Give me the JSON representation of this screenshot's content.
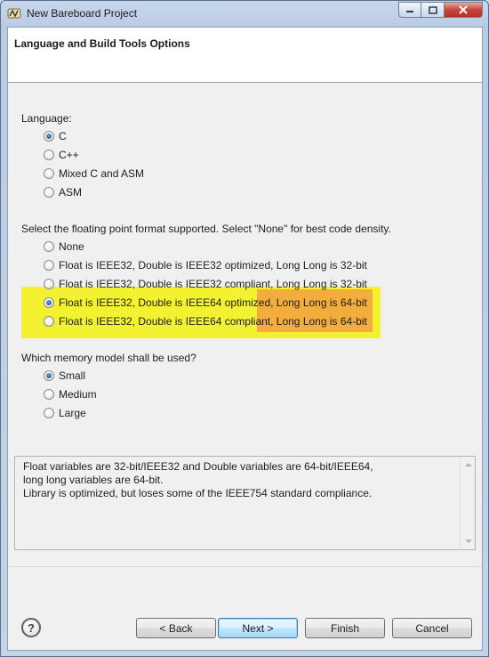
{
  "window": {
    "title": "New Bareboard Project",
    "controls": {
      "minimize": "minimize",
      "maximize": "maximize",
      "close": "close"
    }
  },
  "header": {
    "title": "Language and Build Tools Options"
  },
  "language": {
    "label": "Language:",
    "options": [
      "C",
      "C++",
      "Mixed C and ASM",
      "ASM"
    ],
    "selected": "C"
  },
  "float_format": {
    "label": "Select the floating point format supported. Select \"None\" for best code density.",
    "options": [
      "None",
      "Float is IEEE32, Double is IEEE32 optimized, Long Long is 32-bit",
      "Float is IEEE32, Double is IEEE32 compliant, Long Long is 32-bit",
      "Float is IEEE32, Double is IEEE64 optimized, Long Long is 64-bit",
      "Float is IEEE32, Double is IEEE64 compliant, Long Long is 64-bit"
    ],
    "selected": "Float is IEEE32, Double is IEEE64 optimized, Long Long is 64-bit",
    "highlight_colors": {
      "yellow": "#f2f230",
      "orange": "#f2ad3c"
    }
  },
  "memory_model": {
    "label": "Which memory model shall be used?",
    "options": [
      "Small",
      "Medium",
      "Large"
    ],
    "selected": "Small"
  },
  "description": {
    "lines": [
      "Float variables are 32-bit/IEEE32 and Double variables are 64-bit/IEEE64,",
      "long long variables are 64-bit.",
      "Library is optimized, but loses some of the IEEE754 standard compliance."
    ]
  },
  "footer": {
    "help_icon": "question-mark-icon",
    "help_glyph": "?",
    "back": "< Back",
    "next": "Next >",
    "finish": "Finish",
    "cancel": "Cancel"
  }
}
